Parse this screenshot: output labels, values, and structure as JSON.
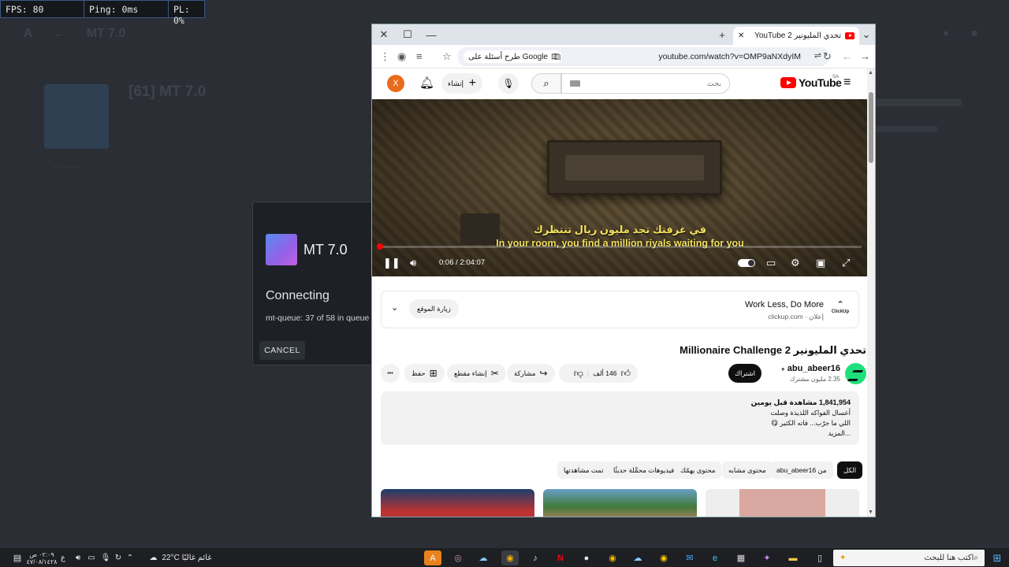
{
  "colors": {
    "youtube_red": "#ff0000",
    "accent_orange": "#e86b1c",
    "subtitle_yellow": "#f2e05a",
    "channel_green": "#1ee07a"
  },
  "fps_bar": {
    "fps": "FPS: 80",
    "ping": "Ping: 0ms",
    "pl": "PL: 0%"
  },
  "background_app": {
    "title": "MT 7.0",
    "item_title": "[61] MT 7.0",
    "item_meta": "-- -- ---"
  },
  "dialog": {
    "title": "MT 7.0",
    "status": "Connecting",
    "queue": "mt-queue: 37 of 58 in queue -",
    "cancel": "CANCEL"
  },
  "browser": {
    "tab_title": "تحدي المليونير YouTube 2 - ...",
    "new_tab": "+",
    "url": "youtube.com/watch?v=OMP9aNXdyIM",
    "google_chip": "طرح أسئلة على Google"
  },
  "youtube": {
    "avatar_letter": "X",
    "create_label": "إنشاء",
    "search_placeholder": "بحث",
    "logo_text": "YouTube",
    "region": "SA",
    "player": {
      "subtitle_ar": "في غرفتك تجد مليون ريال تنتظرك",
      "subtitle_en": "In your room, you find a million riyals waiting for you",
      "time": "0:06 / 2:04:07",
      "progress_fraction": 0.0008
    },
    "ad": {
      "title": "Work Less, Do More",
      "sub": "إعلان · clickup.com",
      "logo": "ClickUp",
      "visit": "زيارة الموقع"
    },
    "video_title": "تحدي المليونير Millionaire Challenge 2",
    "channel": {
      "name": "abu_abeer16",
      "subs": "2.35 مليون مشترك",
      "subscribe": "اشتراك"
    },
    "actions": {
      "like_count": "146 ألف",
      "share": "مشاركة",
      "clip": "إنشاء مقطع",
      "save": "حفظ",
      "more": "•••"
    },
    "description": {
      "stats": "1,841,954 مشاهدة  قبل يومين",
      "line1": "أعسال الفواكه اللذيذة وصلت",
      "line2": "اللي ما جرّب... فاته الكثير 😋",
      "more": "...المزيد"
    },
    "chips": [
      "الكل",
      "من abu_abeer16",
      "محتوى مشابه",
      "محتوى يهمّك",
      "فيديوهات محمَّلة حديثًا",
      "تمت مشاهدتها"
    ]
  },
  "taskbar": {
    "search_placeholder": "اكتب هنا للبحث",
    "weather": "22°C  غائم غالبًا",
    "time": "٠٢:٠٩ ص",
    "date": "٤٧/٠٨/١٤٢٨",
    "lang": "ع"
  }
}
